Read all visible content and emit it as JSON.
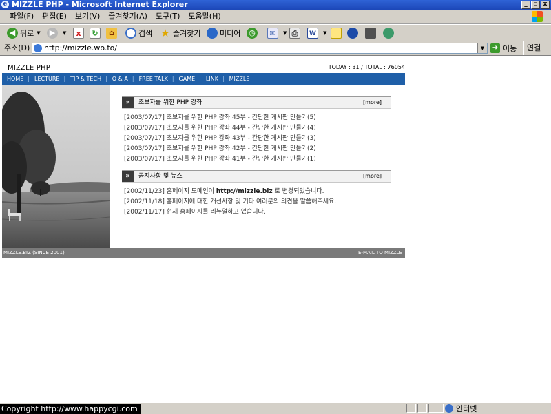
{
  "window": {
    "title": "MIZZLE PHP - Microsoft Internet Explorer",
    "controls": [
      "_",
      "▫",
      "x"
    ]
  },
  "menubar": {
    "items": [
      "파일(F)",
      "편집(E)",
      "보기(V)",
      "즐겨찾기(A)",
      "도구(T)",
      "도움말(H)"
    ]
  },
  "toolbar": {
    "back": "뒤로",
    "search": "검색",
    "favorites": "즐겨찾기",
    "media": "미디어"
  },
  "addressbar": {
    "label": "주소(D)",
    "url": "http://mizzle.wo.to/",
    "go": "이동",
    "links": "연결"
  },
  "site": {
    "logo": "MIZZLE PHP",
    "stats": "TODAY : 31 / TOTAL : 76054",
    "nav": [
      "HOME",
      "LECTURE",
      "TIP & TECH",
      "Q & A",
      "FREE TALK",
      "GAME",
      "LINK",
      "MIZZLE"
    ],
    "sections": [
      {
        "title": "초보자를 위한 PHP 강좌",
        "more": "[more]",
        "items": [
          "[2003/07/17]  초보자를 위한 PHP 강좌 45부 - 간단한 게시판 만들기(5)",
          "[2003/07/17]  초보자를 위한 PHP 강좌 44부 - 간단한 게시판 만들기(4)",
          "[2003/07/17]  초보자를 위한 PHP 강좌 43부 - 간단한 게시판 만들기(3)",
          "[2003/07/17]  초보자를 위한 PHP 강좌 42부 - 간단한 게시판 만들기(2)",
          "[2003/07/17]  초보자를 위한 PHP 강좌 41부 - 간단한 게시판 만들기(1)"
        ]
      },
      {
        "title": "공지사항 및 뉴스",
        "more": "[more]",
        "items": [
          "[2002/11/23]  홈페이지 도메인이 ",
          "[2002/11/18]  홈페이지에 대한 개선사항 및 기타 여러분의 의견을 말씀해주세요.",
          "[2002/11/17]  현재 홈페이지를 리뉴얼하고 있습니다."
        ],
        "first_item_bold": "http://mizzle.biz",
        "first_item_tail": " 로 변경되었습니다."
      }
    ],
    "footer_left": "MIZZLE.BIZ (SINCE 2001)",
    "footer_right": "E-MAIL TO MIZZLE"
  },
  "statusbar": {
    "copyright": "Copyright   http://www.happycgi.com",
    "zone": "인터넷"
  }
}
